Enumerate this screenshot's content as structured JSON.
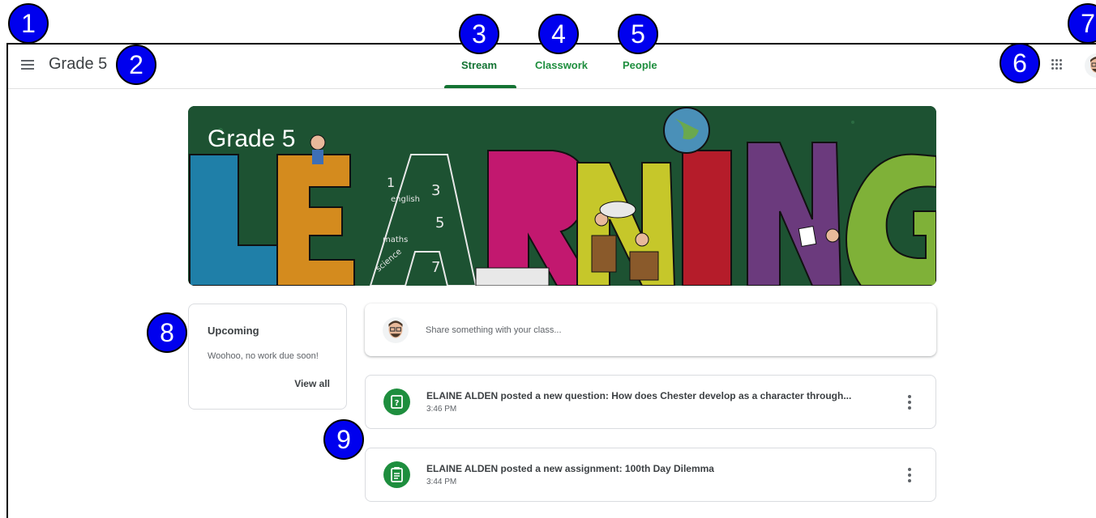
{
  "header": {
    "class_name": "Grade 5",
    "tabs": [
      {
        "label": "Stream",
        "active": true
      },
      {
        "label": "Classwork",
        "active": false
      },
      {
        "label": "People",
        "active": false
      }
    ],
    "menu_icon": "hamburger-menu-icon",
    "apps_icon": "google-apps-grid-icon",
    "avatar_icon": "bitmoji-avatar-icon"
  },
  "banner": {
    "title": "Grade 5",
    "letters": [
      "L",
      "E",
      "A",
      "R",
      "N",
      "I",
      "N",
      "G"
    ],
    "doodles": [
      "1",
      "3",
      "english",
      "5",
      "maths",
      "science",
      "7"
    ]
  },
  "upcoming": {
    "title": "Upcoming",
    "text": "Woohoo, no work due soon!",
    "view_all": "View all"
  },
  "share": {
    "placeholder": "Share something with your class..."
  },
  "posts": [
    {
      "title": "ELAINE ALDEN posted a new question: How does Chester develop as a character through...",
      "time": "3:46 PM",
      "icon": "question-icon"
    },
    {
      "title": "ELAINE ALDEN posted a new assignment: 100th Day Dilemma",
      "time": "3:44 PM",
      "icon": "assignment-icon"
    }
  ],
  "badges": [
    "1",
    "2",
    "3",
    "4",
    "5",
    "6",
    "7",
    "8",
    "9"
  ],
  "colors": {
    "accent_green": "#1e8e3e",
    "badge_blue": "#0000ee",
    "banner_bg": "#1d5232"
  }
}
